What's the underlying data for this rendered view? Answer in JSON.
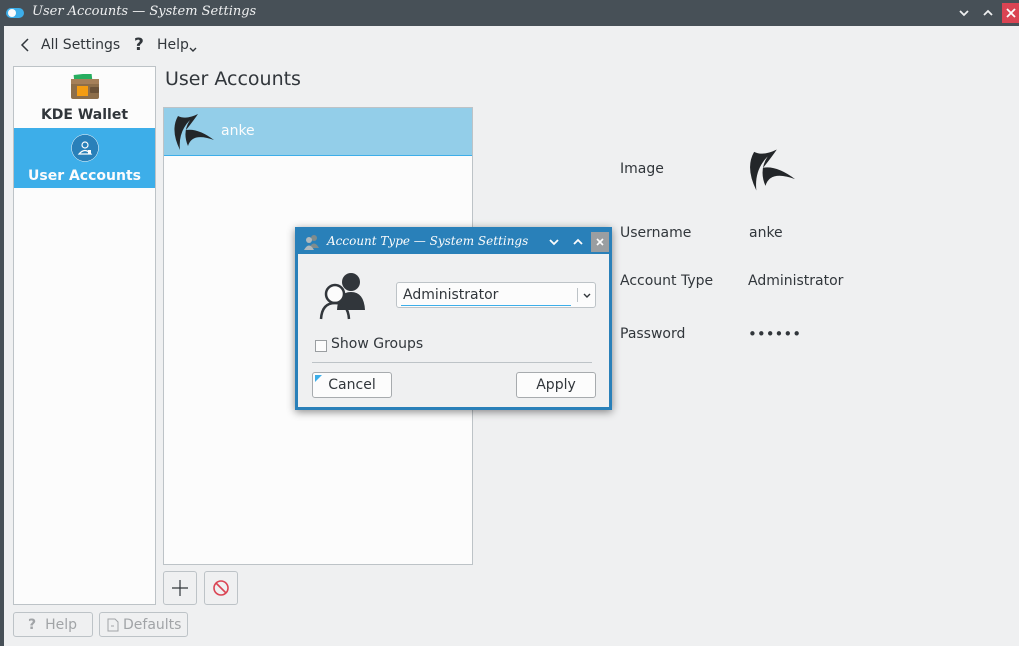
{
  "window": {
    "title": "User Accounts — System Settings"
  },
  "toolbar": {
    "back_label": "All Settings",
    "help_label": "Help"
  },
  "sidebar": {
    "items": [
      {
        "label": "KDE Wallet",
        "icon": "wallet-icon",
        "active": false
      },
      {
        "label": "User Accounts",
        "icon": "user-accounts-icon",
        "active": true
      }
    ]
  },
  "main": {
    "title": "User Accounts",
    "users": [
      {
        "name": "anke",
        "selected": true
      }
    ]
  },
  "details": {
    "image_label": "Image",
    "username_label": "Username",
    "username_value": "anke",
    "account_type_label": "Account Type",
    "account_type_value": "Administrator",
    "password_label": "Password",
    "password_value": "••••••"
  },
  "footer": {
    "help_label": "Help",
    "defaults_label": "Defaults"
  },
  "dialog": {
    "title": "Account Type — System Settings",
    "selected_type": "Administrator",
    "show_groups_label": "Show Groups",
    "show_groups_checked": false,
    "cancel_label": "Cancel",
    "apply_label": "Apply"
  },
  "colors": {
    "accent": "#3daee9",
    "titlebar": "#475057",
    "dialog_titlebar": "#2980b9",
    "selection": "#93cee9"
  }
}
